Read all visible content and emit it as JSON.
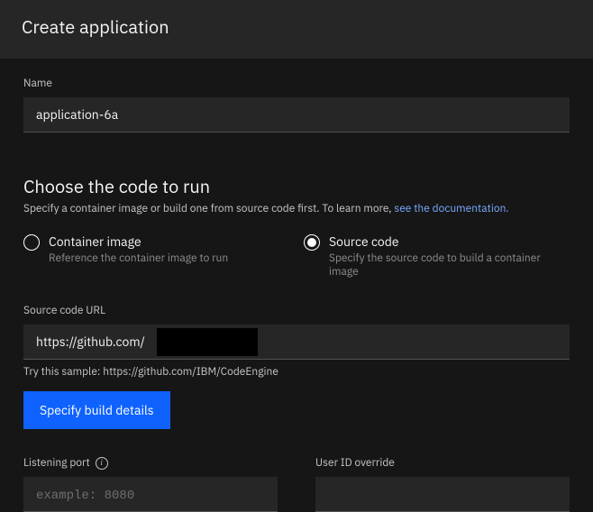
{
  "header": {
    "title": "Create application"
  },
  "name": {
    "label": "Name",
    "value": "application-6a"
  },
  "codeSection": {
    "title": "Choose the code to run",
    "descPrefix": "Specify a container image or build one from source code first. To learn more, ",
    "linkText": "see the documentation."
  },
  "radios": {
    "container": {
      "title": "Container image",
      "desc": "Reference the container image to run"
    },
    "source": {
      "title": "Source code",
      "desc": "Specify the source code to build a container image"
    }
  },
  "sourceUrl": {
    "label": "Source code URL",
    "value": "https://github.com/                              o",
    "sampleText": "Try this sample: https://github.com/IBM/CodeEngine"
  },
  "buildButton": "Specify build details",
  "listeningPort": {
    "label": "Listening port",
    "placeholder": "example: 8080"
  },
  "userId": {
    "label": "User ID override",
    "value": ""
  }
}
